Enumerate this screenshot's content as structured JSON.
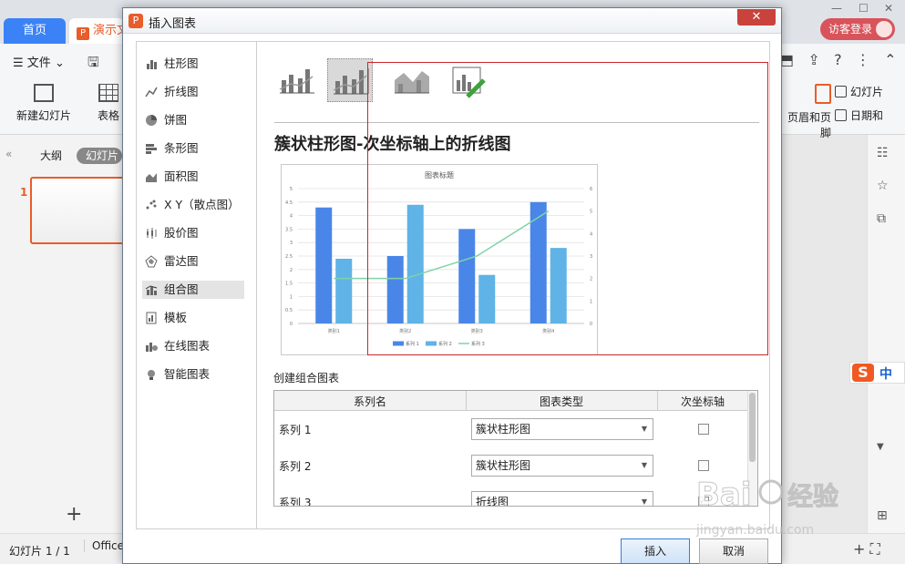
{
  "app": {
    "tabs": [
      "首页",
      "演示文"
    ],
    "visitor_login": "访客登录",
    "file_menu": "文件",
    "new_slide": "新建幻灯片",
    "table": "表格",
    "header_footer": "页眉和页脚",
    "slide_library": "幻灯片",
    "date_time": "日期和",
    "outline_tab": "大纲",
    "slides_tab": "幻灯片",
    "slide_number": "1",
    "status_slide_count": "幻灯片 1 / 1",
    "status_office": "Office",
    "ime_label": "中"
  },
  "dialog": {
    "title": "插入图表",
    "close_glyph": "✕",
    "chart_types": [
      {
        "label": "柱形图",
        "icon": "column-chart-icon"
      },
      {
        "label": "折线图",
        "icon": "line-chart-icon"
      },
      {
        "label": "饼图",
        "icon": "pie-chart-icon"
      },
      {
        "label": "条形图",
        "icon": "bar-chart-icon"
      },
      {
        "label": "面积图",
        "icon": "area-chart-icon"
      },
      {
        "label": "X Y（散点图）",
        "icon": "scatter-chart-icon"
      },
      {
        "label": "股价图",
        "icon": "stock-chart-icon"
      },
      {
        "label": "雷达图",
        "icon": "radar-chart-icon"
      },
      {
        "label": "组合图",
        "icon": "combo-chart-icon"
      },
      {
        "label": "模板",
        "icon": "template-icon"
      },
      {
        "label": "在线图表",
        "icon": "online-chart-icon"
      },
      {
        "label": "智能图表",
        "icon": "smart-chart-icon"
      }
    ],
    "selected_type": "组合图",
    "preview_title": "簇状柱形图-次坐标轴上的折线图",
    "combo_label": "创建组合图表",
    "table_headers": [
      "系列名",
      "图表类型",
      "次坐标轴"
    ],
    "rows": [
      {
        "name": "系列 1",
        "type": "簇状柱形图",
        "secondary": false
      },
      {
        "name": "系列 2",
        "type": "簇状柱形图",
        "secondary": false
      },
      {
        "name": "系列 3",
        "type": "折线图",
        "secondary": true
      }
    ],
    "insert_button": "插入",
    "cancel_button": "取消"
  },
  "chart_data": {
    "type": "bar",
    "title": "图表标题",
    "categories": [
      "类别1",
      "类别2",
      "类别3",
      "类别4"
    ],
    "series": [
      {
        "name": "系列 1",
        "type": "bar",
        "values": [
          4.3,
          2.5,
          3.5,
          4.5
        ],
        "color": "#4a86e8"
      },
      {
        "name": "系列 2",
        "type": "bar",
        "values": [
          2.4,
          4.4,
          1.8,
          2.8
        ],
        "color": "#5fb3e6"
      },
      {
        "name": "系列 3",
        "type": "line",
        "axis": "secondary",
        "values": [
          2,
          2,
          3,
          5
        ],
        "color": "#7dd3a8"
      }
    ],
    "ylim": [
      0,
      5
    ],
    "y_ticks": [
      "0",
      "0.5",
      "1",
      "1.5",
      "2",
      "2.5",
      "3",
      "3.5",
      "4",
      "4.5",
      "5"
    ],
    "y2lim": [
      0,
      6
    ],
    "y2_ticks": [
      "0",
      "1",
      "2",
      "3",
      "4",
      "5",
      "6"
    ],
    "legend": "bottom",
    "grid": true
  },
  "watermark": {
    "text": "Baidu经验",
    "subtext": "jingyan.baidu.com"
  }
}
